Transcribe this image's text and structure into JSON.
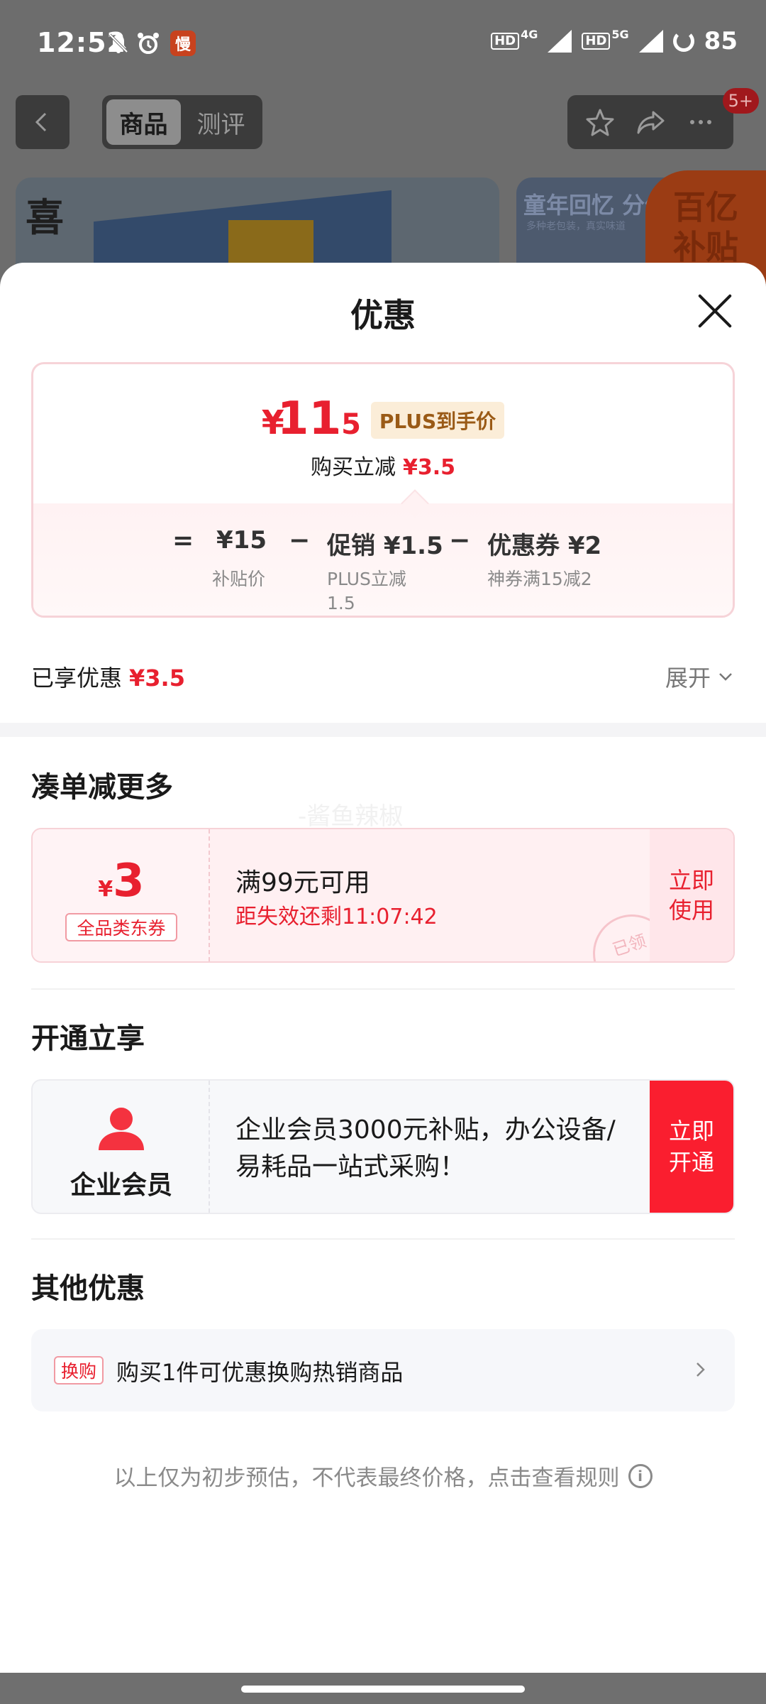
{
  "status_bar": {
    "time": "12:52",
    "hd1": "HD",
    "net1": "4G",
    "hd2": "HD",
    "net2": "5G",
    "battery": "85",
    "icons": [
      "mute-bell-icon",
      "alarm-icon",
      "app-notification-icon"
    ]
  },
  "top_nav": {
    "tabs": [
      "商品",
      "测评"
    ],
    "active_tab": "商品",
    "badge": "5+",
    "icons": [
      "back-icon",
      "star-icon",
      "share-icon",
      "more-icon"
    ]
  },
  "background_banner": {
    "left_text": "喜",
    "right_title": "童年回忆 分份",
    "right_sub": "多种老包装，真实味道",
    "subsidy_badge": [
      "百亿",
      "补贴"
    ]
  },
  "sheet": {
    "title": "优惠",
    "price": {
      "currency": "¥",
      "integer": "11",
      "decimal": ".5",
      "tag": "PLUS到手价",
      "buy_label": "购买立减",
      "buy_amount": "¥3.5"
    },
    "formula": {
      "equals": "=",
      "minus": "−",
      "items": [
        {
          "value": "¥15",
          "label": "补贴价"
        },
        {
          "value": "促销 ¥1.5",
          "label_line1": "PLUS立减",
          "label_line2": "1.5"
        },
        {
          "value": "优惠券 ¥2",
          "label": "神券满15减2"
        }
      ]
    },
    "enjoyed": {
      "label": "已享优惠",
      "amount": "¥3.5"
    },
    "expand_label": "展开",
    "section_coupon": {
      "title": "凑单减更多",
      "watermark": "-酱鱼辣椒",
      "coupon": {
        "currency": "¥",
        "amount": "3",
        "tag": "全品类东券",
        "condition": "满99元可用",
        "countdown": "距失效还剩11:07:42",
        "button_line1": "立即",
        "button_line2": "使用",
        "stamp": "已领"
      }
    },
    "section_member": {
      "title": "开通立享",
      "name": "企业会员",
      "desc": " 企业会员3000元补贴，办公设备/易耗品一站式采购！",
      "button_line1": "立即",
      "button_line2": "开通"
    },
    "section_other": {
      "title": "其他优惠",
      "tag": "换购",
      "text": "购买1件可优惠换购热销商品"
    },
    "disclaimer": "以上仅为初步预估，不代表最终价格，点击查看规则",
    "colors": {
      "accent_red": "#e8202f",
      "button_red": "#fa1e2f",
      "plus_tag_bg": "#fbedd8"
    }
  }
}
